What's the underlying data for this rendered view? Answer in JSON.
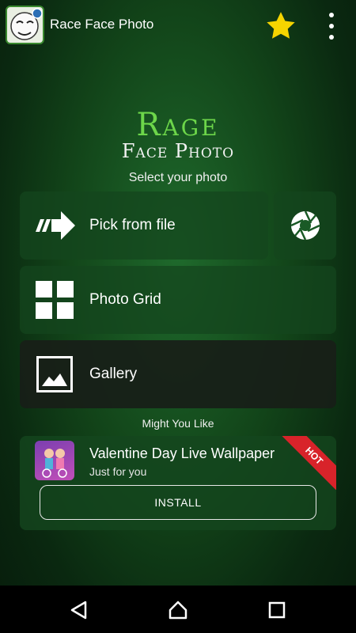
{
  "appbar": {
    "title": "Race Face Photo",
    "icons": [
      "app-face-icon",
      "star-icon",
      "overflow-menu-icon"
    ]
  },
  "logo": {
    "line1": "Rage",
    "line2": "Face Photo"
  },
  "select_label": "Select your photo",
  "actions": {
    "pick_from_file": "Pick from file",
    "photo_grid": "Photo Grid",
    "gallery": "Gallery"
  },
  "might_you_like": "Might You Like",
  "ad": {
    "title": "Valentine Day Live Wallpaper",
    "subtitle": "Just for you",
    "badge": "HOT",
    "install_label": "INSTALL"
  },
  "colors": {
    "accent_green": "#6dd64a",
    "star": "#f5d400",
    "hot_badge": "#d8232a"
  }
}
